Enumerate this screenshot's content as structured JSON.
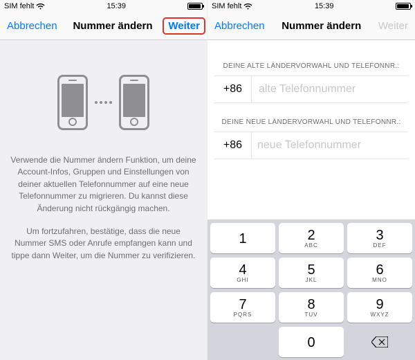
{
  "status": {
    "carrier": "SIM fehlt",
    "time": "15:39",
    "wifi": "􀙇"
  },
  "nav": {
    "cancel": "Abbrechen",
    "title": "Nummer ändern",
    "next": "Weiter"
  },
  "screen1": {
    "p1": "Verwende die Nummer ändern Funktion, um deine Account-Infos, Gruppen und Einstellungen von deiner aktuellen Telefonnummer auf eine neue Telefonnummer zu migrieren. Du kannst diese Änderung nicht rückgängig machen.",
    "p2": "Um fortzufahren, bestätige, dass die neue Nummer SMS oder Anrufe empfangen kann und tippe dann Weiter, um die Nummer zu verifizieren."
  },
  "screen2": {
    "old_label": "DEINE ALTE LÄNDERVORWAHL UND TELEFONNR.:",
    "new_label": "DEINE NEUE LÄNDERVORWAHL UND TELEFONNR.:",
    "cc": "+86",
    "old_placeholder": "alte Telefonnummer",
    "new_placeholder": "neue Telefonnummer"
  },
  "keypad": {
    "keys": [
      {
        "n": "1",
        "s": ""
      },
      {
        "n": "2",
        "s": "ABC"
      },
      {
        "n": "3",
        "s": "DEF"
      },
      {
        "n": "4",
        "s": "GHI"
      },
      {
        "n": "5",
        "s": "JKL"
      },
      {
        "n": "6",
        "s": "MNO"
      },
      {
        "n": "7",
        "s": "PQRS"
      },
      {
        "n": "8",
        "s": "TUV"
      },
      {
        "n": "9",
        "s": "WXYZ"
      },
      {
        "n": "0",
        "s": ""
      }
    ]
  }
}
